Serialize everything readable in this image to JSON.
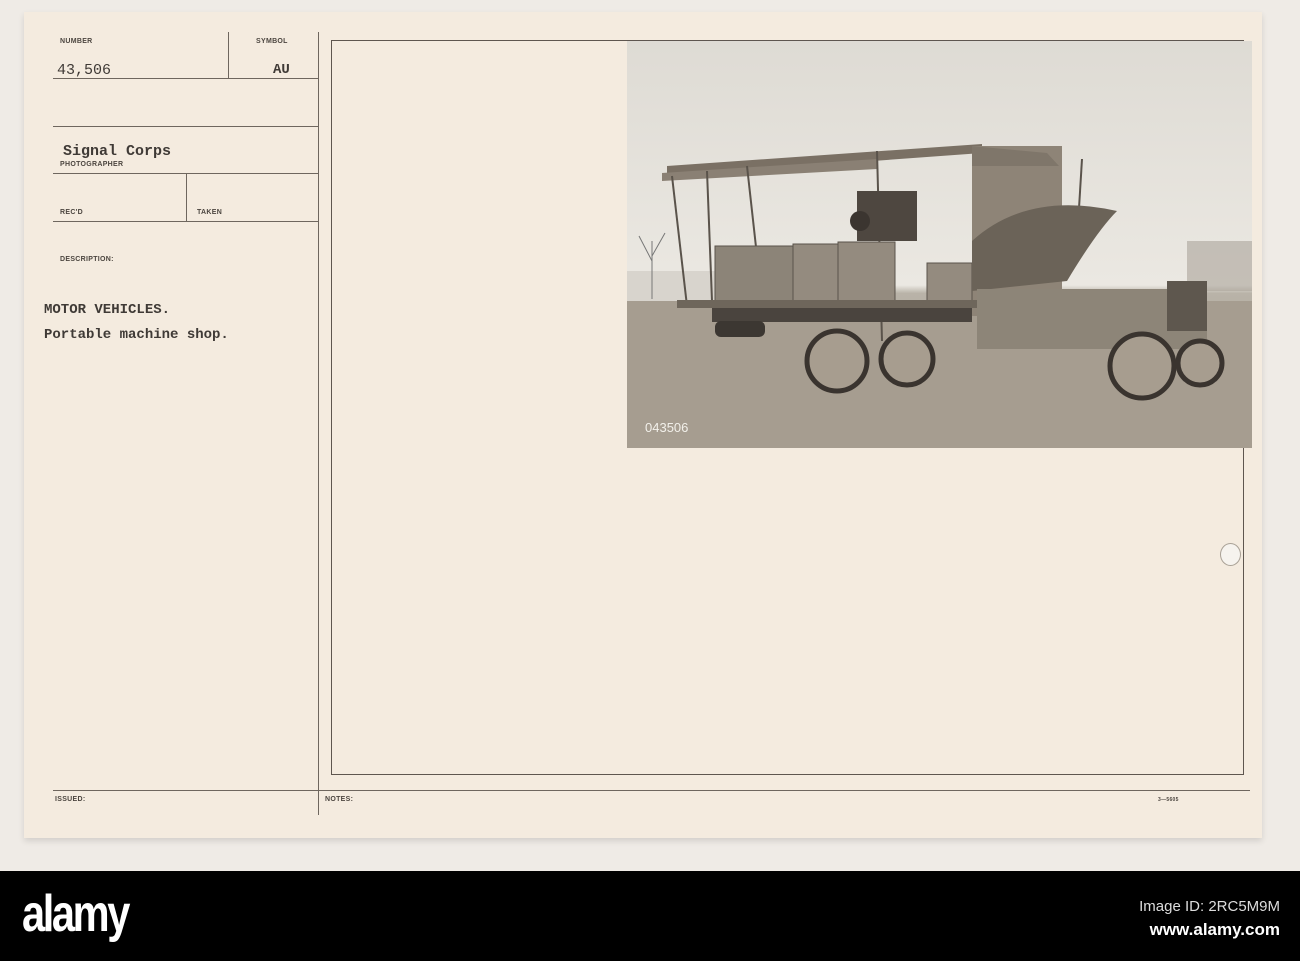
{
  "card": {
    "number_label": "NUMBER",
    "number_value": "43,506",
    "symbol_label": "SYMBOL",
    "symbol_value": "AU",
    "photographer_value": "Signal Corps",
    "photographer_label": "PHOTOGRAPHER",
    "recd_label": "REC'D",
    "taken_label": "TAKEN",
    "description_label": "DESCRIPTION:",
    "description_line1": "MOTOR VEHICLES.",
    "description_line2": "Portable machine shop.",
    "issued_label": "ISSUED:",
    "notes_label": "NOTES:",
    "form_number": "3—5605"
  },
  "photo": {
    "negative_number": "043506"
  },
  "footer": {
    "logo": "alamy",
    "image_id": "Image ID: 2RC5M9M",
    "url": "www.alamy.com"
  }
}
